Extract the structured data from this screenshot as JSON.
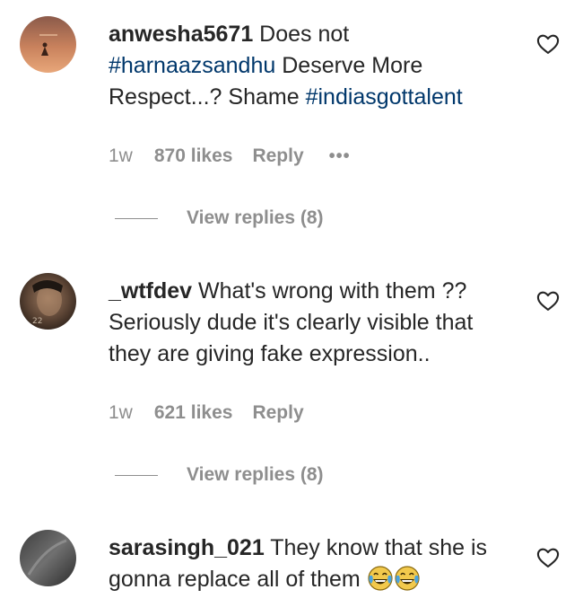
{
  "comments": [
    {
      "username": "anwesha5671",
      "text_before": "Does not",
      "hashtag1": "#harnaazsandhu",
      "text_middle": "Deserve More Respect...? Shame",
      "hashtag2": "#indiasgottalent",
      "time": "1w",
      "likes": "870 likes",
      "reply": "Reply",
      "more": "•••",
      "view_replies": "View replies (8)"
    },
    {
      "username": "_wtfdev",
      "text": "What's wrong with them ?? Seriously dude it's clearly visible that they are giving fake expression..",
      "time": "1w",
      "likes": "621 likes",
      "reply": "Reply",
      "view_replies": "View replies (8)"
    },
    {
      "username": "sarasingh_021",
      "text": "They know that she is gonna replace all of them",
      "emojis": [
        "face-with-tears-of-joy-emoji",
        "face-with-tears-of-joy-emoji"
      ]
    }
  ],
  "colors": {
    "text": "#262626",
    "muted": "#8e8e8e",
    "hashtag": "#00376b"
  },
  "icons": {
    "like": "heart-outline-icon"
  }
}
